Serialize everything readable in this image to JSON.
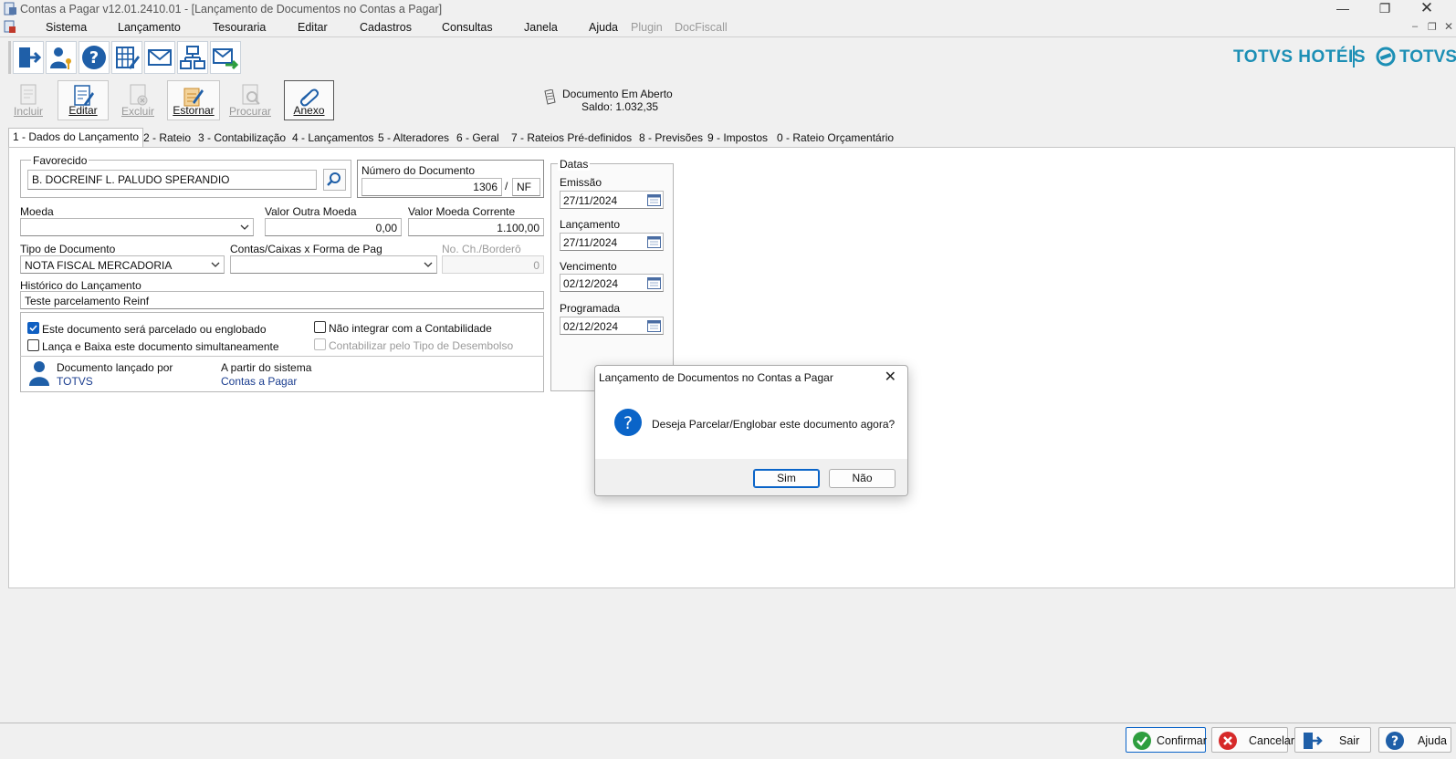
{
  "window": {
    "title": "Contas a Pagar v12.01.2410.01 - [Lançamento de Documentos no Contas a Pagar]"
  },
  "menu": [
    "Sistema",
    "Lançamento",
    "Tesouraria",
    "Editar",
    "Cadastros",
    "Consultas",
    "Janela",
    "Ajuda"
  ],
  "menu_disabled": [
    "Plugin",
    "DocFiscall"
  ],
  "brand": {
    "left": "TOTVS HOTÉIS",
    "right": "TOTVS"
  },
  "toolbar": {
    "incluir": "Incluir",
    "editar": "Editar",
    "excluir": "Excluir",
    "estornar": "Estornar",
    "procurar": "Procurar",
    "anexo": "Anexo"
  },
  "status": {
    "line1": "Documento Em Aberto",
    "line2": "Saldo: 1.032,35"
  },
  "tabs": [
    "1 - Dados do Lançamento",
    "2 - Rateio",
    "3 - Contabilização",
    "4 - Lançamentos",
    "5 - Alteradores",
    "6 - Geral",
    "7 - Rateios Pré-definidos",
    "8 - Previsões",
    "9 - Impostos",
    "0 - Rateio Orçamentário"
  ],
  "form": {
    "favorecido_label": "Favorecido",
    "favorecido_value": "B. DOCREINF  L. PALUDO SPERANDIO",
    "numdoc_label": "Número do Documento",
    "numdoc_value": "1306",
    "numdoc_sep": "/",
    "numdoc_serie": "NF",
    "moeda_label": "Moeda",
    "moeda_value": "",
    "valor_outra_label": "Valor Outra Moeda",
    "valor_outra_value": "0,00",
    "valor_corrente_label": "Valor Moeda Corrente",
    "valor_corrente_value": "1.100,00",
    "tipodoc_label": "Tipo de Documento",
    "tipodoc_value": "NOTA FISCAL MERCADORIA",
    "contas_label": "Contas/Caixas x Forma de Pag",
    "contas_value": "",
    "noch_label": "No. Ch./Borderô",
    "noch_value": "0",
    "historico_label": "Histórico do Lançamento",
    "historico_value": "Teste parcelamento Reinf",
    "chk_parcelado": "Este documento será parcelado ou englobado",
    "chk_lanca_baixa": "Lança e Baixa este documento simultaneamente",
    "chk_nao_integrar": "Não integrar com a Contabilidade",
    "chk_contabilizar": "Contabilizar pelo Tipo de Desembolso",
    "lancado_por_label": "Documento lançado por",
    "lancado_por_value": "TOTVS",
    "sistema_label": "A partir do sistema",
    "sistema_value": "Contas a Pagar"
  },
  "datas": {
    "title": "Datas",
    "emissao_label": "Emissão",
    "emissao_value": "27/11/2024",
    "lancamento_label": "Lançamento",
    "lancamento_value": "27/11/2024",
    "vencimento_label": "Vencimento",
    "vencimento_value": "02/12/2024",
    "programada_label": "Programada",
    "programada_value": "02/12/2024"
  },
  "dialog": {
    "title": "Lançamento de Documentos no Contas a Pagar",
    "message": "Deseja Parcelar/Englobar este documento agora?",
    "yes": "Sim",
    "no": "Não"
  },
  "bottom": {
    "confirmar": "Confirmar",
    "cancelar": "Cancelar",
    "sair": "Sair",
    "ajuda": "Ajuda"
  }
}
